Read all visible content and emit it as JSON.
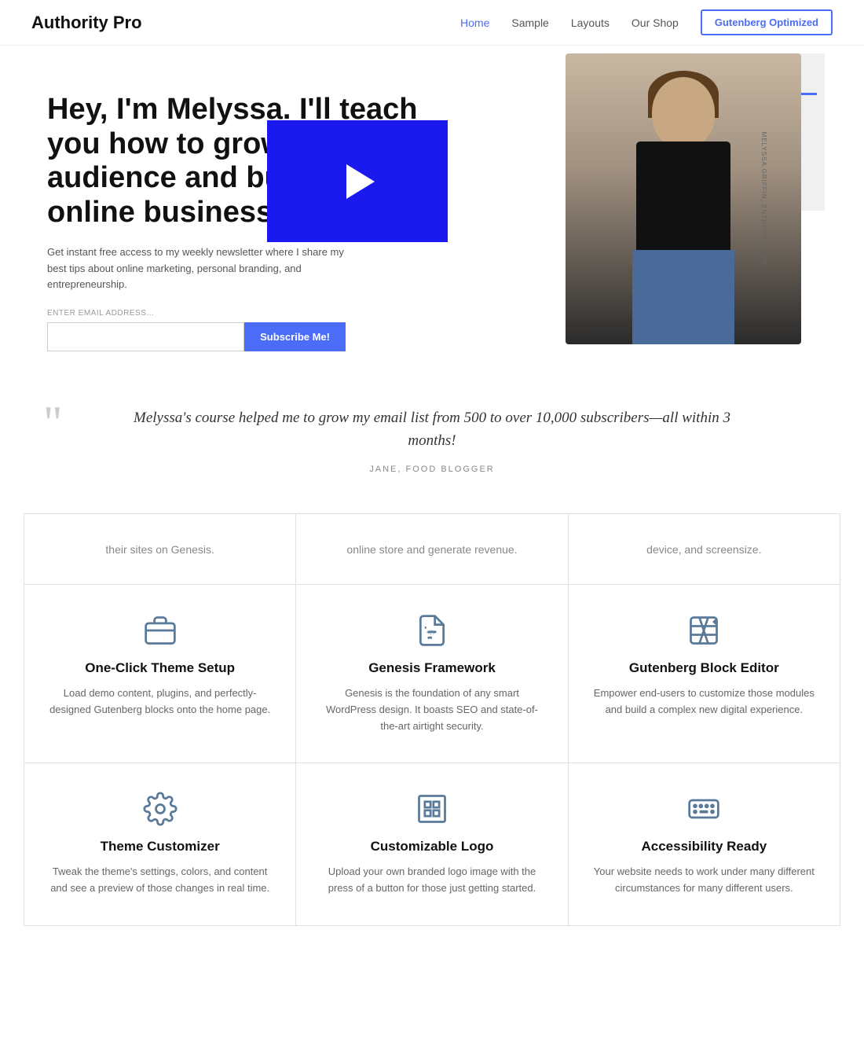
{
  "nav": {
    "logo": "Authority Pro",
    "links": [
      {
        "label": "Home",
        "active": true
      },
      {
        "label": "Sample",
        "active": false
      },
      {
        "label": "Layouts",
        "active": false
      },
      {
        "label": "Our Shop",
        "active": false
      }
    ],
    "cta_button": "Gutenberg Optimized"
  },
  "hero": {
    "title": "Hey, I'm Melyssa. I'll teach you how to grow your audience and build an online business.",
    "subtitle": "Get instant free access to my weekly newsletter where I share my best tips about online marketing, personal branding, and entrepreneurship.",
    "email_label": "ENTER EMAIL ADDRESS...",
    "subscribe_btn": "Subscribe Me!",
    "image_label": "MELYSSA GRIFFIN, ENTREPREUNER"
  },
  "quote": {
    "text": "Melyssa's course helped me to grow my email list from 500 to over 10,000 subscribers—all within 3 months!",
    "author": "JANE, FOOD BLOGGER"
  },
  "partial_rows": [
    {
      "col1": "their sites on Genesis.",
      "col2": "online store and generate revenue.",
      "col3": "device, and screensize."
    }
  ],
  "features": [
    {
      "icon": "briefcase",
      "title": "One-Click Theme Setup",
      "desc": "Load demo content, plugins, and perfectly-designed Gutenberg blocks onto the home page."
    },
    {
      "icon": "code",
      "title": "Genesis Framework",
      "desc": "Genesis is the foundation of any smart WordPress design. It boasts SEO and state-of-the-art airtight security."
    },
    {
      "icon": "edit",
      "title": "Gutenberg Block Editor",
      "desc": "Empower end-users to customize those modules and build a complex new digital experience."
    },
    {
      "icon": "gear",
      "title": "Theme Customizer",
      "desc": "Tweak the theme's settings, colors, and content and see a preview of those changes in real time."
    },
    {
      "icon": "logo",
      "title": "Customizable Logo",
      "desc": "Upload your own branded logo image with the press of a button for those just getting started."
    },
    {
      "icon": "keyboard",
      "title": "Accessibility Ready",
      "desc": "Your website needs to work under many different circumstances for many different users."
    }
  ]
}
